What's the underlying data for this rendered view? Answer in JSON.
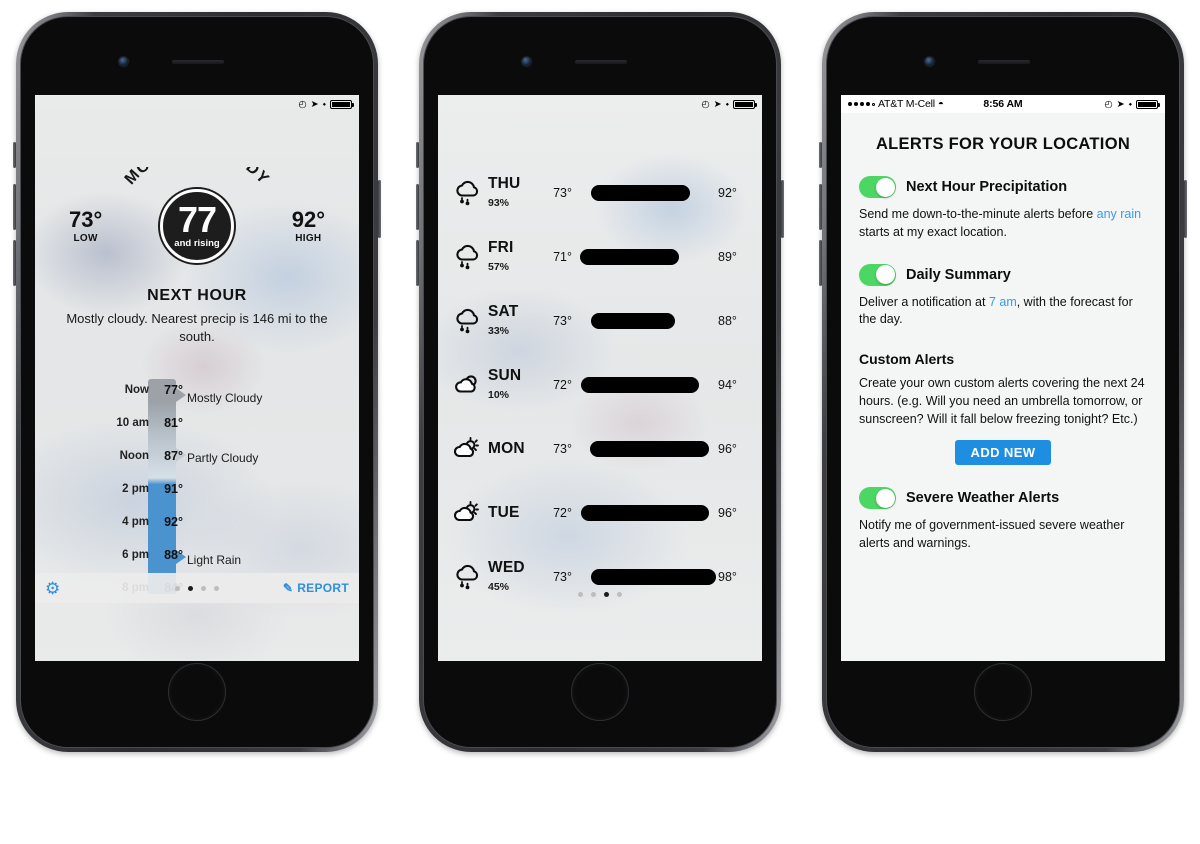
{
  "status_bar": {
    "carrier": "AT&T M-Cell",
    "time": "8:56 AM",
    "wifi_icon": "wifi-icon",
    "alarm_icon": "alarm-icon",
    "location_icon": "location-arrow-icon",
    "bluetooth_icon": "bluetooth-icon",
    "battery_icon": "battery-icon"
  },
  "phone1": {
    "current": {
      "condition": "MOSTLY CLOUDY",
      "temp": "77",
      "trend": "and rising",
      "low_temp": "73°",
      "low_label": "LOW",
      "high_temp": "92°",
      "high_label": "HIGH"
    },
    "next_hour": {
      "title": "NEXT HOUR",
      "description": "Mostly cloudy. Nearest precip is 146 mi to the south."
    },
    "timeline": {
      "rows": [
        {
          "time": "Now",
          "temp": "77°"
        },
        {
          "time": "10 am",
          "temp": "81°"
        },
        {
          "time": "Noon",
          "temp": "87°"
        },
        {
          "time": "2 pm",
          "temp": "91°"
        },
        {
          "time": "4 pm",
          "temp": "92°"
        },
        {
          "time": "6 pm",
          "temp": "88°"
        },
        {
          "time": "8 pm",
          "temp": "84°"
        }
      ],
      "labels": [
        {
          "text": "Mostly Cloudy"
        },
        {
          "text": "Partly Cloudy"
        },
        {
          "text": "Light Rain"
        }
      ]
    },
    "bottom_bar": {
      "settings_icon": "gear-icon",
      "report_label": "REPORT",
      "report_icon": "pencil-icon",
      "active_dot": 1
    }
  },
  "phone2": {
    "days": [
      {
        "day": "THU",
        "precip": "93%",
        "icon": "rain-cloud-icon",
        "low": "73°",
        "high": "92°",
        "bar_start": 12,
        "bar_end": 82
      },
      {
        "day": "FRI",
        "precip": "57%",
        "icon": "rain-cloud-icon",
        "low": "71°",
        "high": "89°",
        "bar_start": 4,
        "bar_end": 74
      },
      {
        "day": "SAT",
        "precip": "33%",
        "icon": "rain-cloud-icon",
        "low": "73°",
        "high": "88°",
        "bar_start": 12,
        "bar_end": 71
      },
      {
        "day": "SUN",
        "precip": "10%",
        "icon": "sun-behind-cloud-icon",
        "low": "72°",
        "high": "94°",
        "bar_start": 5,
        "bar_end": 88
      },
      {
        "day": "MON",
        "precip": "",
        "icon": "sun-cloud-rays-icon",
        "low": "73°",
        "high": "96°",
        "bar_start": 11,
        "bar_end": 94
      },
      {
        "day": "TUE",
        "precip": "",
        "icon": "sun-cloud-rays-icon",
        "low": "72°",
        "high": "96°",
        "bar_start": 5,
        "bar_end": 94
      },
      {
        "day": "WED",
        "precip": "45%",
        "icon": "rain-cloud-icon",
        "low": "73°",
        "high": "98°",
        "bar_start": 12,
        "bar_end": 99
      }
    ],
    "active_dot": 2
  },
  "phone3": {
    "title": "ALERTS FOR YOUR LOCATION",
    "items": [
      {
        "label": "Next Hour Precipitation",
        "toggle_on": true,
        "desc_pre": "Send me down-to-the-minute alerts before ",
        "desc_link": "any rain",
        "desc_post": " starts at my exact location."
      },
      {
        "label": "Daily Summary",
        "toggle_on": true,
        "desc_pre": "Deliver a notification at ",
        "desc_link": "7 am",
        "desc_post": ", with the forecast for the day."
      }
    ],
    "custom_alerts": {
      "heading": "Custom Alerts",
      "description": "Create your own custom alerts covering the next 24 hours. (e.g. Will you need an umbrella tomorrow, or sunscreen? Will it fall below freezing tonight? Etc.)",
      "button_label": "ADD NEW"
    },
    "severe": {
      "label": "Severe Weather Alerts",
      "toggle_on": true,
      "description": "Notify me of government-issued severe weather alerts and warnings."
    },
    "active_dot": 3
  },
  "colors": {
    "accent_blue": "#2d8fe0",
    "toggle_green": "#4cd663",
    "link_blue": "#3a9ae8",
    "rain_bar": "#4a93cf"
  }
}
